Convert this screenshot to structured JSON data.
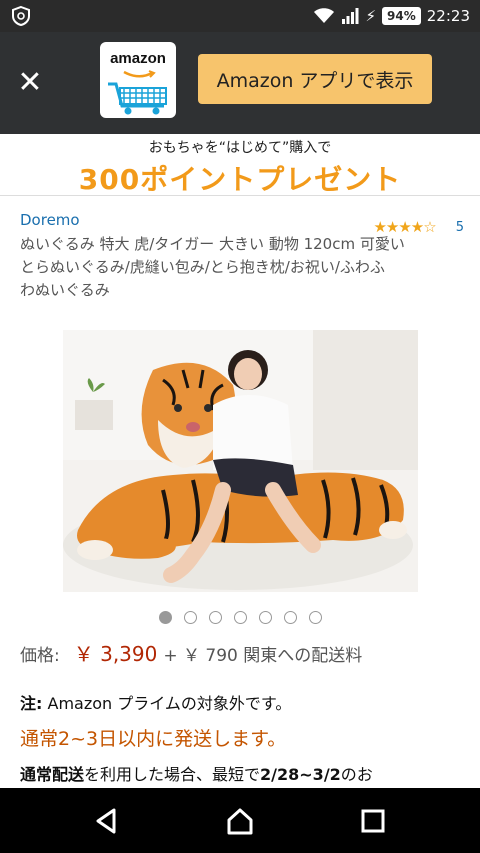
{
  "status_bar": {
    "battery": "94%",
    "time": "22:23"
  },
  "app_banner": {
    "app_name": "amazon",
    "open_button_label": "Amazon アプリで表示"
  },
  "promo": {
    "line1": "おもちゃを“はじめて”購入で",
    "line2": "300ポイントプレゼント"
  },
  "product": {
    "brand": "Doremo",
    "rating_count": "5",
    "title_lines": [
      "ぬいぐるみ 特大 虎/タイガー 大きい 動物 120cm 可愛い",
      "とらぬいぐるみ/虎縫い包み/とら抱き枕/お祝い/ふわふ",
      "わぬいぐるみ"
    ],
    "image_count": 7,
    "active_image_index": 0
  },
  "pricing": {
    "label": "価格:",
    "price": "￥ 3,390",
    "shipping": "+ ￥ 790 関東への配送料"
  },
  "info": {
    "prime_prefix": "注:",
    "prime_text": " Amazon プライムの対象外です。",
    "fast_ship": "通常2~3日以内に発送します。",
    "std_ship_bold": "通常配送",
    "std_ship_rest": "を利用した場合、最短で",
    "std_ship_dates": "2/28~3/2",
    "std_ship_tail": "のお"
  },
  "colors": {
    "accent_orange": "#f29a1a",
    "price_red": "#b12704",
    "link_blue": "#1a6fae",
    "button_yellow": "#f7c46c"
  }
}
